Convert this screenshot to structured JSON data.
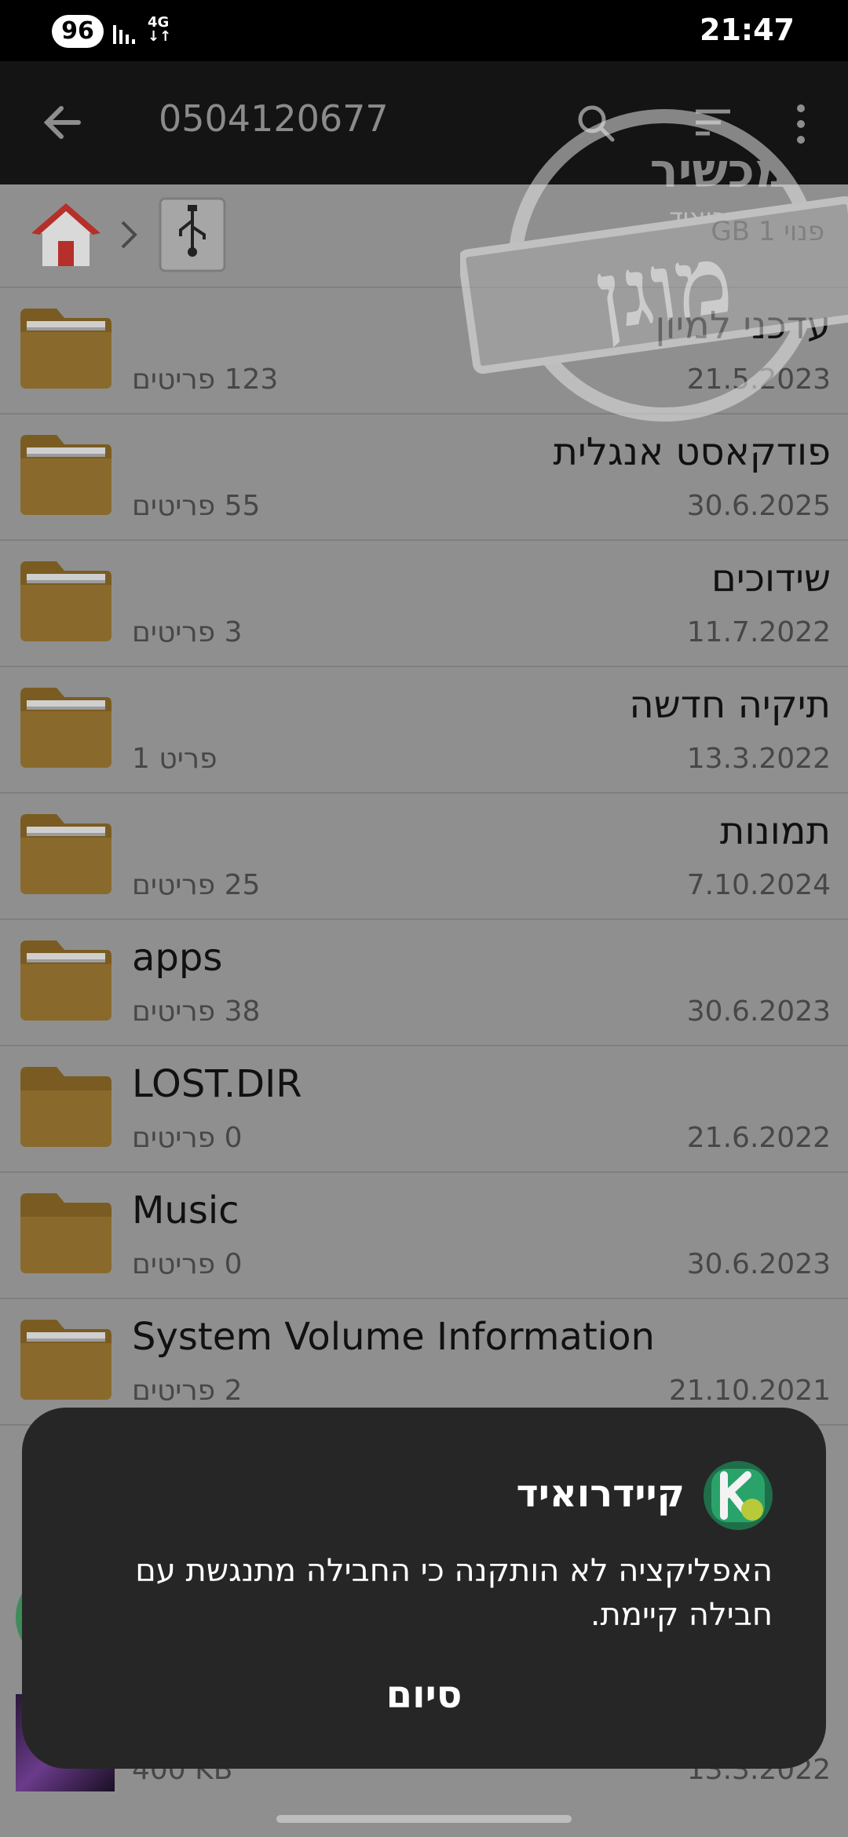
{
  "status_bar": {
    "battery": "96",
    "network": "4G",
    "time": "21:47"
  },
  "toolbar": {
    "title": "0504120677",
    "icons": [
      "back-arrow-icon",
      "search-icon",
      "sort-icon",
      "more-vert-icon"
    ]
  },
  "breadcrumb": {
    "free_space": "פנוי 1 GB"
  },
  "files": [
    {
      "name": "עדכני למיון",
      "count": "123 פריטים",
      "date": "21.5.2023",
      "dir": "rtl"
    },
    {
      "name": "פודקאסט אנגלית",
      "count": "55 פריטים",
      "date": "30.6.2025",
      "dir": "rtl"
    },
    {
      "name": "שידוכים",
      "count": "3 פריטים",
      "date": "11.7.2022",
      "dir": "rtl"
    },
    {
      "name": "תיקיה חדשה",
      "count": "פריט 1",
      "date": "13.3.2022",
      "dir": "rtl"
    },
    {
      "name": "תמונות",
      "count": "25 פריטים",
      "date": "7.10.2024",
      "dir": "rtl"
    },
    {
      "name": "apps",
      "count": "38 פריטים",
      "date": "30.6.2023",
      "dir": "ltr"
    },
    {
      "name": "LOST.DIR",
      "count": "0 פריטים",
      "date": "21.6.2022",
      "dir": "ltr"
    },
    {
      "name": "Music",
      "count": "0 פריטים",
      "date": "30.6.2023",
      "dir": "ltr"
    },
    {
      "name": "System Volume Information",
      "count": "2 פריטים",
      "date": "21.10.2021",
      "dir": "ltr"
    }
  ],
  "partial_rows": [
    {
      "size": "400 KB",
      "date": "13.3.2022"
    }
  ],
  "watermark": {
    "main": "מוגן",
    "top": "מכשיר",
    "sub": "קיידרואיד"
  },
  "dialog": {
    "app_name": "קיידרואיד",
    "message": "האפליקציה לא הותקנה כי החבילה מתנגשת עם חבילה קיימת.",
    "done_label": "סיום"
  },
  "colors": {
    "folder": "#8a6a2c",
    "dialog_bg": "#262626",
    "toolbar_bg": "#141414"
  }
}
